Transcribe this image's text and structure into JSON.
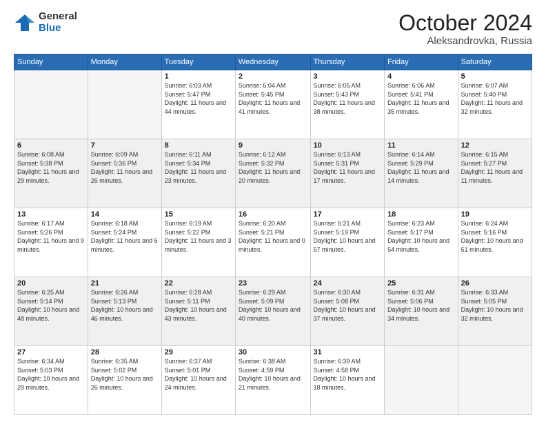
{
  "header": {
    "logo_general": "General",
    "logo_blue": "Blue",
    "month_title": "October 2024",
    "location": "Aleksandrovka, Russia"
  },
  "days_of_week": [
    "Sunday",
    "Monday",
    "Tuesday",
    "Wednesday",
    "Thursday",
    "Friday",
    "Saturday"
  ],
  "weeks": [
    [
      {
        "num": "",
        "info": ""
      },
      {
        "num": "",
        "info": ""
      },
      {
        "num": "1",
        "info": "Sunrise: 6:03 AM\nSunset: 5:47 PM\nDaylight: 11 hours and 44 minutes."
      },
      {
        "num": "2",
        "info": "Sunrise: 6:04 AM\nSunset: 5:45 PM\nDaylight: 11 hours and 41 minutes."
      },
      {
        "num": "3",
        "info": "Sunrise: 6:05 AM\nSunset: 5:43 PM\nDaylight: 11 hours and 38 minutes."
      },
      {
        "num": "4",
        "info": "Sunrise: 6:06 AM\nSunset: 5:41 PM\nDaylight: 11 hours and 35 minutes."
      },
      {
        "num": "5",
        "info": "Sunrise: 6:07 AM\nSunset: 5:40 PM\nDaylight: 11 hours and 32 minutes."
      }
    ],
    [
      {
        "num": "6",
        "info": "Sunrise: 6:08 AM\nSunset: 5:38 PM\nDaylight: 11 hours and 29 minutes."
      },
      {
        "num": "7",
        "info": "Sunrise: 6:09 AM\nSunset: 5:36 PM\nDaylight: 11 hours and 26 minutes."
      },
      {
        "num": "8",
        "info": "Sunrise: 6:11 AM\nSunset: 5:34 PM\nDaylight: 11 hours and 23 minutes."
      },
      {
        "num": "9",
        "info": "Sunrise: 6:12 AM\nSunset: 5:32 PM\nDaylight: 11 hours and 20 minutes."
      },
      {
        "num": "10",
        "info": "Sunrise: 6:13 AM\nSunset: 5:31 PM\nDaylight: 11 hours and 17 minutes."
      },
      {
        "num": "11",
        "info": "Sunrise: 6:14 AM\nSunset: 5:29 PM\nDaylight: 11 hours and 14 minutes."
      },
      {
        "num": "12",
        "info": "Sunrise: 6:15 AM\nSunset: 5:27 PM\nDaylight: 11 hours and 11 minutes."
      }
    ],
    [
      {
        "num": "13",
        "info": "Sunrise: 6:17 AM\nSunset: 5:26 PM\nDaylight: 11 hours and 9 minutes."
      },
      {
        "num": "14",
        "info": "Sunrise: 6:18 AM\nSunset: 5:24 PM\nDaylight: 11 hours and 6 minutes."
      },
      {
        "num": "15",
        "info": "Sunrise: 6:19 AM\nSunset: 5:22 PM\nDaylight: 11 hours and 3 minutes."
      },
      {
        "num": "16",
        "info": "Sunrise: 6:20 AM\nSunset: 5:21 PM\nDaylight: 11 hours and 0 minutes."
      },
      {
        "num": "17",
        "info": "Sunrise: 6:21 AM\nSunset: 5:19 PM\nDaylight: 10 hours and 57 minutes."
      },
      {
        "num": "18",
        "info": "Sunrise: 6:23 AM\nSunset: 5:17 PM\nDaylight: 10 hours and 54 minutes."
      },
      {
        "num": "19",
        "info": "Sunrise: 6:24 AM\nSunset: 5:16 PM\nDaylight: 10 hours and 51 minutes."
      }
    ],
    [
      {
        "num": "20",
        "info": "Sunrise: 6:25 AM\nSunset: 5:14 PM\nDaylight: 10 hours and 48 minutes."
      },
      {
        "num": "21",
        "info": "Sunrise: 6:26 AM\nSunset: 5:13 PM\nDaylight: 10 hours and 46 minutes."
      },
      {
        "num": "22",
        "info": "Sunrise: 6:28 AM\nSunset: 5:11 PM\nDaylight: 10 hours and 43 minutes."
      },
      {
        "num": "23",
        "info": "Sunrise: 6:29 AM\nSunset: 5:09 PM\nDaylight: 10 hours and 40 minutes."
      },
      {
        "num": "24",
        "info": "Sunrise: 6:30 AM\nSunset: 5:08 PM\nDaylight: 10 hours and 37 minutes."
      },
      {
        "num": "25",
        "info": "Sunrise: 6:31 AM\nSunset: 5:06 PM\nDaylight: 10 hours and 34 minutes."
      },
      {
        "num": "26",
        "info": "Sunrise: 6:33 AM\nSunset: 5:05 PM\nDaylight: 10 hours and 32 minutes."
      }
    ],
    [
      {
        "num": "27",
        "info": "Sunrise: 6:34 AM\nSunset: 5:03 PM\nDaylight: 10 hours and 29 minutes."
      },
      {
        "num": "28",
        "info": "Sunrise: 6:35 AM\nSunset: 5:02 PM\nDaylight: 10 hours and 26 minutes."
      },
      {
        "num": "29",
        "info": "Sunrise: 6:37 AM\nSunset: 5:01 PM\nDaylight: 10 hours and 24 minutes."
      },
      {
        "num": "30",
        "info": "Sunrise: 6:38 AM\nSunset: 4:59 PM\nDaylight: 10 hours and 21 minutes."
      },
      {
        "num": "31",
        "info": "Sunrise: 6:39 AM\nSunset: 4:58 PM\nDaylight: 10 hours and 18 minutes."
      },
      {
        "num": "",
        "info": ""
      },
      {
        "num": "",
        "info": ""
      }
    ]
  ]
}
